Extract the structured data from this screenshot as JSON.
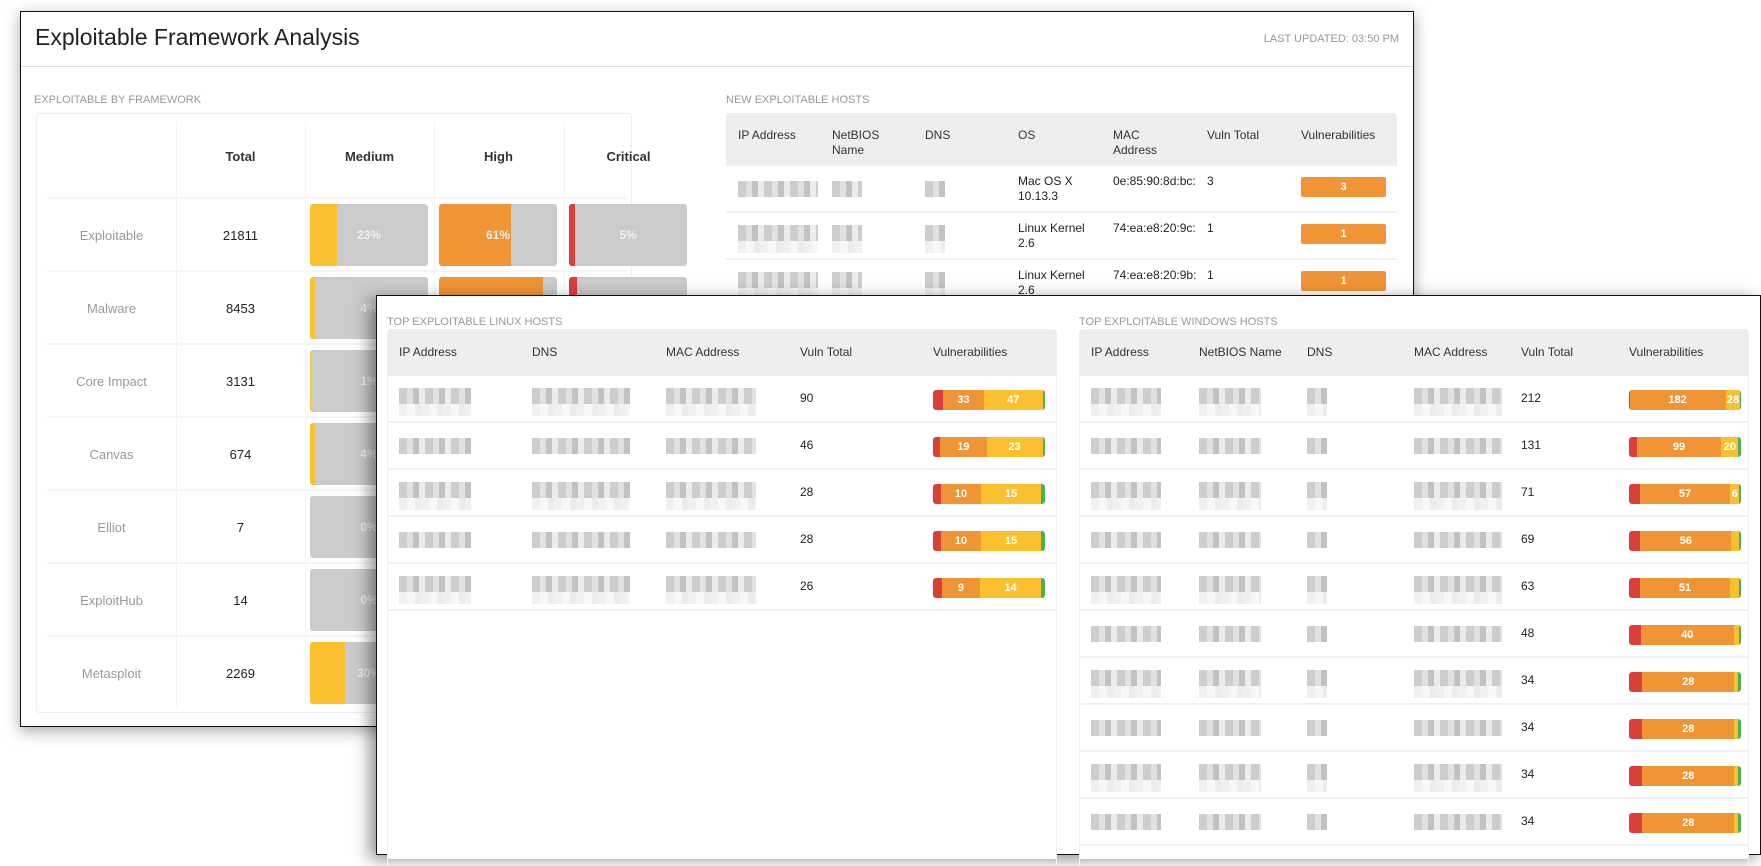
{
  "colors": {
    "critical": "#d9403a",
    "high": "#ef9535",
    "medium": "#fbc02d",
    "low": "#4caf50",
    "empty": "#cbcbcb",
    "header_bg": "#eeeeee"
  },
  "header": {
    "title": "Exploitable Framework Analysis",
    "last_updated": "LAST UPDATED: 03:50 PM"
  },
  "framework": {
    "label": "EXPLOITABLE BY FRAMEWORK",
    "columns": [
      "",
      "Total",
      "Medium",
      "High",
      "Critical"
    ],
    "rows": [
      {
        "name": "Exploitable",
        "total": "21811",
        "medium": 23,
        "medium_label": "23%",
        "high": 61,
        "high_label": "61%",
        "critical": 5,
        "critical_label": "5%"
      },
      {
        "name": "Malware",
        "total": "8453",
        "medium": 4,
        "medium_label": "4%",
        "high": 88,
        "high_label": "",
        "critical": 7,
        "critical_label": ""
      },
      {
        "name": "Core Impact",
        "total": "3131",
        "medium": 1,
        "medium_label": "1%"
      },
      {
        "name": "Canvas",
        "total": "674",
        "medium": 4,
        "medium_label": "4%"
      },
      {
        "name": "Elliot",
        "total": "7",
        "medium": 0,
        "medium_label": "0%"
      },
      {
        "name": "ExploitHub",
        "total": "14",
        "medium": 0,
        "medium_label": "0%"
      },
      {
        "name": "Metasploit",
        "total": "2269",
        "medium": 30,
        "medium_label": "30%"
      }
    ]
  },
  "new_hosts": {
    "label": "NEW EXPLOITABLE HOSTS",
    "columns": [
      "IP Address",
      "NetBIOS Name",
      "DNS",
      "OS",
      "MAC Address",
      "Vuln Total",
      "Vulnerabilities"
    ],
    "rows": [
      {
        "os": "Mac OS X 10.13.3",
        "mac": "0e:85:90:8d:bc:",
        "vuln_total": "3",
        "vulns": "3"
      },
      {
        "os": "Linux Kernel 2.6",
        "mac": "74:ea:e8:20:9c:",
        "vuln_total": "1",
        "vulns": "1"
      },
      {
        "os": "Linux Kernel 2.6",
        "mac": "74:ea:e8:20:9b:",
        "vuln_total": "1",
        "vulns": "1"
      }
    ]
  },
  "linux_hosts": {
    "label": "TOP EXPLOITABLE LINUX HOSTS",
    "columns": [
      "IP Address",
      "DNS",
      "MAC Address",
      "Vuln Total",
      "Vulnerabilities"
    ],
    "rows": [
      {
        "vuln_total": "90",
        "critical": 8,
        "high": 33,
        "medium": 47,
        "low": 2
      },
      {
        "vuln_total": "46",
        "critical": 3,
        "high": 19,
        "medium": 23,
        "low": 1
      },
      {
        "vuln_total": "28",
        "critical": 2,
        "high": 10,
        "medium": 15,
        "low": 1
      },
      {
        "vuln_total": "28",
        "critical": 2,
        "high": 10,
        "medium": 15,
        "low": 1
      },
      {
        "vuln_total": "26",
        "critical": 2,
        "high": 9,
        "medium": 14,
        "low": 1
      }
    ]
  },
  "windows_hosts": {
    "label": "TOP EXPLOITABLE WINDOWS HOSTS",
    "columns": [
      "IP Address",
      "NetBIOS Name",
      "DNS",
      "MAC Address",
      "Vuln Total",
      "Vulnerabilities"
    ],
    "rows": [
      {
        "vuln_total": "212",
        "critical": 1,
        "high": 182,
        "medium": 28,
        "low": 1
      },
      {
        "vuln_total": "131",
        "critical": 9,
        "high": 99,
        "medium": 20,
        "low": 3
      },
      {
        "vuln_total": "71",
        "critical": 7,
        "high": 57,
        "medium": 6,
        "low": 1
      },
      {
        "vuln_total": "69",
        "critical": 7,
        "high": 56,
        "medium": 5,
        "low": 1
      },
      {
        "vuln_total": "63",
        "critical": 6,
        "high": 51,
        "medium": 5,
        "low": 1
      },
      {
        "vuln_total": "48",
        "critical": 5,
        "high": 40,
        "medium": 2,
        "low": 1
      },
      {
        "vuln_total": "34",
        "critical": 4,
        "high": 28,
        "medium": 1,
        "low": 1
      },
      {
        "vuln_total": "34",
        "critical": 4,
        "high": 28,
        "medium": 1,
        "low": 1
      },
      {
        "vuln_total": "34",
        "critical": 4,
        "high": 28,
        "medium": 1,
        "low": 1
      },
      {
        "vuln_total": "34",
        "critical": 4,
        "high": 28,
        "medium": 1,
        "low": 1
      }
    ]
  }
}
